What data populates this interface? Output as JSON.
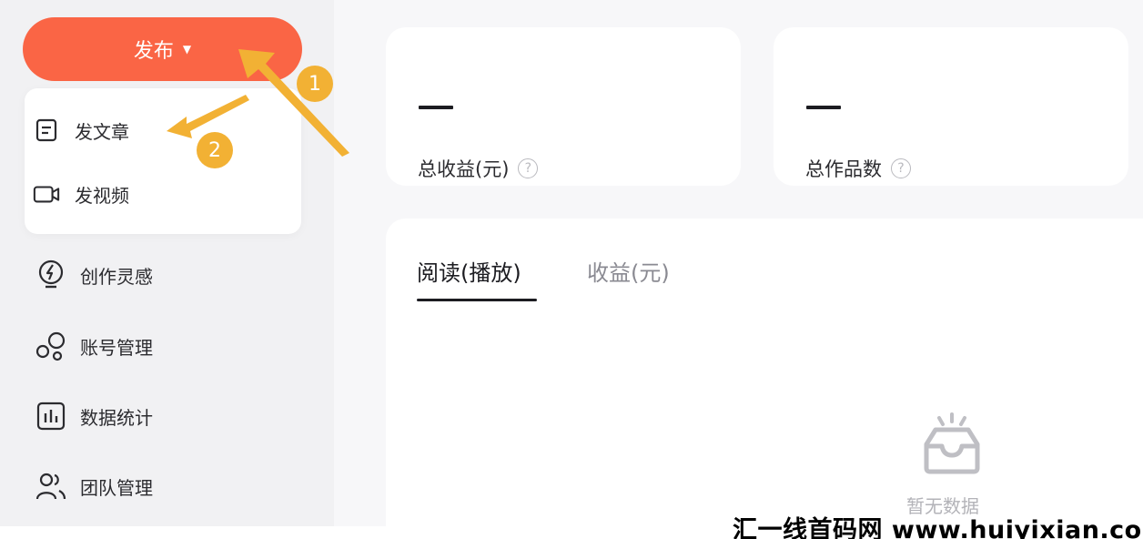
{
  "sidebar": {
    "publish_button": {
      "label": "发布",
      "caret_icon": "caret-down-icon"
    },
    "publish_menu": [
      {
        "label": "发文章",
        "icon": "document-icon"
      },
      {
        "label": "发视频",
        "icon": "video-camera-icon"
      }
    ],
    "nav_items": [
      {
        "label": "创作灵感",
        "icon": "lightbulb-bolt-icon"
      },
      {
        "label": "账号管理",
        "icon": "account-circles-icon"
      },
      {
        "label": "数据统计",
        "icon": "bar-chart-icon"
      },
      {
        "label": "团队管理",
        "icon": "team-users-icon"
      }
    ]
  },
  "stats": [
    {
      "label": "总收益(元)",
      "help_icon": "question-circle-icon"
    },
    {
      "label": "总作品数",
      "help_icon": "question-circle-icon"
    }
  ],
  "tabs": [
    {
      "label": "阅读(播放)",
      "active": true
    },
    {
      "label": "收益(元)",
      "active": false
    }
  ],
  "empty_state": {
    "text": "暂无数据",
    "icon": "empty-inbox-icon"
  },
  "annotations": [
    {
      "number": "1"
    },
    {
      "number": "2"
    }
  ],
  "watermark": "汇一线首码网 www.huiyixian.com",
  "colors": {
    "brand": "#fa6545",
    "annotation": "#f2b134",
    "sidebar_bg": "#f1f1f3"
  }
}
